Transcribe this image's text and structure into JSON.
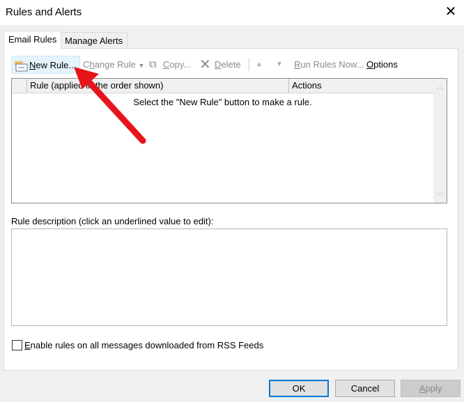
{
  "window": {
    "title": "Rules and Alerts",
    "close_icon": "close-icon"
  },
  "tabs": [
    {
      "label": "Email Rules",
      "active": true
    },
    {
      "label": "Manage Alerts",
      "active": false
    }
  ],
  "toolbar": {
    "new_rule": {
      "mn": "N",
      "rest": "ew Rule..."
    },
    "change_rule": {
      "pre": "C",
      "mn": "h",
      "rest": "ange Rule"
    },
    "copy": {
      "mn": "C",
      "rest": "opy..."
    },
    "delete": {
      "mn": "D",
      "rest": "elete"
    },
    "run_rules": {
      "mn": "R",
      "rest": "un Rules Now..."
    },
    "options": {
      "mn": "O",
      "rest": "ptions"
    }
  },
  "rules_list": {
    "columns": [
      "Rule (applied in the order shown)",
      "Actions"
    ],
    "empty_message": "Select the \"New Rule\" button to make a rule.",
    "rows": []
  },
  "description": {
    "label": "Rule description (click an underlined value to edit):",
    "value": ""
  },
  "rss_checkbox": {
    "mn": "E",
    "rest": "nable rules on all messages downloaded from RSS Feeds",
    "checked": false
  },
  "buttons": {
    "ok": "OK",
    "cancel": "Cancel",
    "apply_mn": "A",
    "apply_rest": "pply"
  },
  "colors": {
    "annotation_arrow": "#e8141b",
    "accent": "#0078d7"
  }
}
